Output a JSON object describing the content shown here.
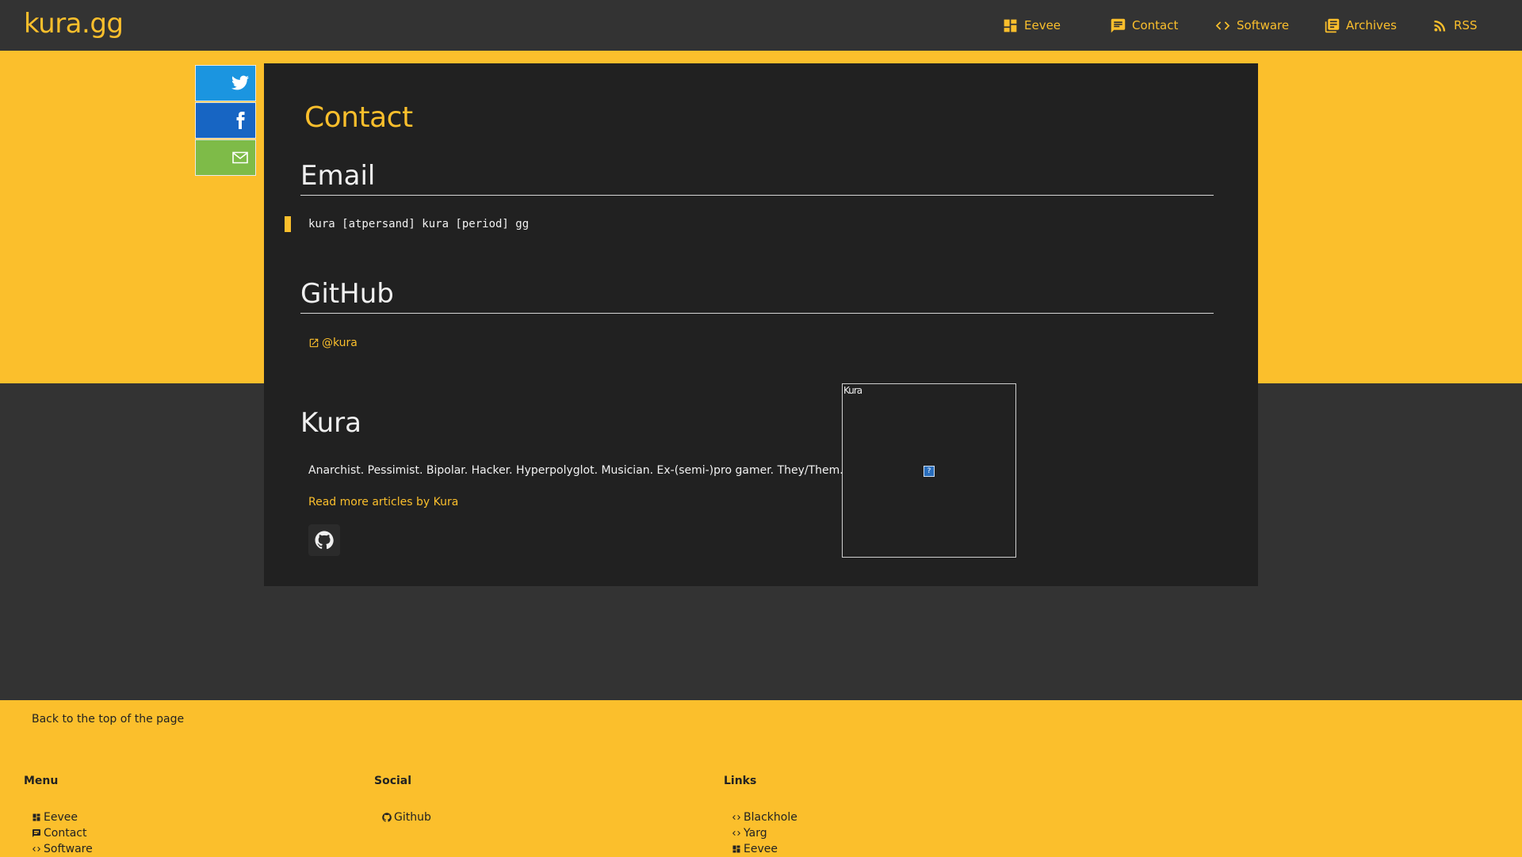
{
  "site": {
    "brand": "kura.gg",
    "accent_color": "#fbbf2c",
    "dark_color": "#333333",
    "card_color": "#212121"
  },
  "nav": {
    "items": [
      {
        "label": "Eevee",
        "icon": "dashboard-icon"
      },
      {
        "label": "Contact",
        "icon": "chat-icon"
      },
      {
        "label": "Software",
        "icon": "code-icon"
      },
      {
        "label": "Archives",
        "icon": "library-books-icon"
      },
      {
        "label": "RSS",
        "icon": "rss-icon"
      }
    ]
  },
  "share": {
    "buttons": [
      {
        "network": "twitter",
        "icon": "twitter-icon",
        "color": "#1b95e0"
      },
      {
        "network": "facebook",
        "icon": "facebook-icon",
        "color": "#1765c3"
      },
      {
        "network": "email",
        "icon": "mail-icon",
        "color": "#7ebb48"
      }
    ]
  },
  "article": {
    "title": "Contact",
    "email_heading": "Email",
    "email_text": "kura [atpersand] kura [period] gg",
    "github_heading": "GitHub",
    "github_link": "@kura"
  },
  "author": {
    "name": "Kura",
    "bio": "Anarchist. Pessimist. Bipolar. Hacker. Hyperpolyglot. Musician. Ex-(semi-)pro gamer. They/Them.",
    "more_link": "Read more articles by Kura",
    "avatar_alt": "Kura",
    "broken_image_glyph": "?"
  },
  "footer": {
    "back_to_top": "Back to the top of the page",
    "menu_heading": "Menu",
    "menu_items": [
      {
        "label": "Eevee",
        "icon": "dashboard-icon"
      },
      {
        "label": "Contact",
        "icon": "chat-icon"
      },
      {
        "label": "Software",
        "icon": "code-icon"
      }
    ],
    "social_heading": "Social",
    "social_items": [
      {
        "label": "Github",
        "icon": "github-icon"
      }
    ],
    "links_heading": "Links",
    "links_items": [
      {
        "label": "Blackhole",
        "icon": "code-icon"
      },
      {
        "label": "Yarg",
        "icon": "code-icon"
      },
      {
        "label": "Eevee",
        "icon": "dashboard-icon"
      }
    ]
  }
}
